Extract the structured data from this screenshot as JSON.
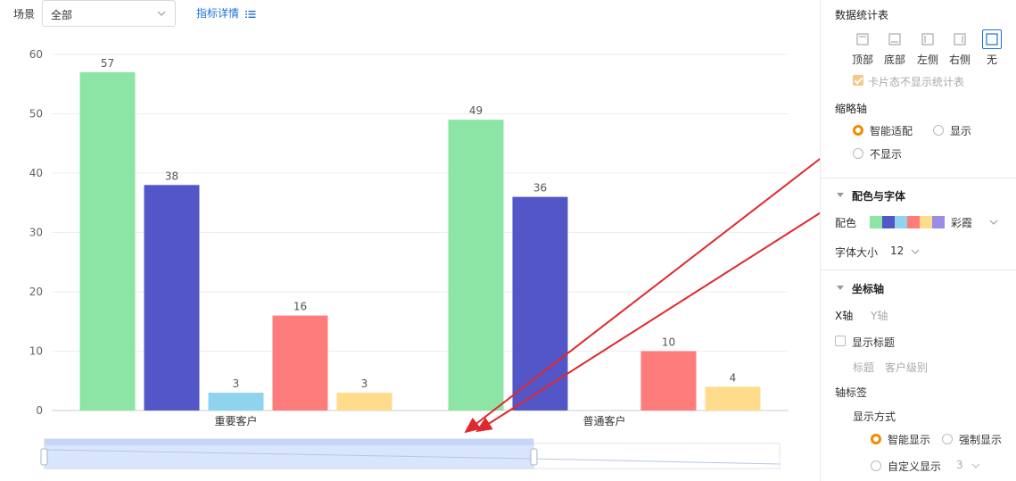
{
  "filter": {
    "scene_label": "场景",
    "scene_value": "全部",
    "detail_link": "指标详情"
  },
  "chart_data": {
    "type": "bar",
    "categories": [
      "重要客户",
      "普通客户"
    ],
    "series": [
      {
        "color": "#8ce5a5",
        "values": [
          57,
          49
        ]
      },
      {
        "color": "#5356c6",
        "values": [
          38,
          36
        ]
      },
      {
        "color": "#8ed4ef",
        "values": [
          3,
          null
        ]
      },
      {
        "color": "#ff7c7c",
        "values": [
          16,
          10
        ]
      },
      {
        "color": "#ffdc8c",
        "values": [
          3,
          4
        ]
      }
    ],
    "ylim": [
      0,
      60
    ],
    "yticks": [
      0,
      10,
      20,
      30,
      40,
      50,
      60
    ],
    "grid": true
  },
  "panel": {
    "stats_title": "数据统计表",
    "positions": [
      {
        "label": "顶部",
        "icon": "top-layout-icon"
      },
      {
        "label": "底部",
        "icon": "bottom-layout-icon"
      },
      {
        "label": "左侧",
        "icon": "left-layout-icon"
      },
      {
        "label": "右侧",
        "icon": "right-layout-icon"
      },
      {
        "label": "无",
        "icon": "none-layout-icon",
        "selected": true
      }
    ],
    "card_hide_label": "卡片态不显示统计表",
    "thumb_title": "缩略轴",
    "thumb_opt_smart": "智能适配",
    "thumb_opt_show": "显示",
    "thumb_opt_hide": "不显示",
    "color_font_title": "配色与字体",
    "color_label": "配色",
    "palette_name": "彩霞",
    "palette": [
      "#8ce5a5",
      "#5356c6",
      "#8ed4ef",
      "#ff7c7c",
      "#ffdc8c",
      "#9a8de8"
    ],
    "font_size_label": "字体大小",
    "font_size_value": "12",
    "axis_title": "坐标轴",
    "x_axis_tab": "X轴",
    "y_axis_tab": "Y轴",
    "show_title_label": "显示标题",
    "title_label": "标题",
    "title_value": "客户级别",
    "axis_tick_title": "轴标签",
    "display_mode_label": "显示方式",
    "mode_smart": "智能显示",
    "mode_force": "强制显示",
    "mode_custom": "自定义显示",
    "custom_value": "3"
  },
  "annotation_color": "#e0282e"
}
